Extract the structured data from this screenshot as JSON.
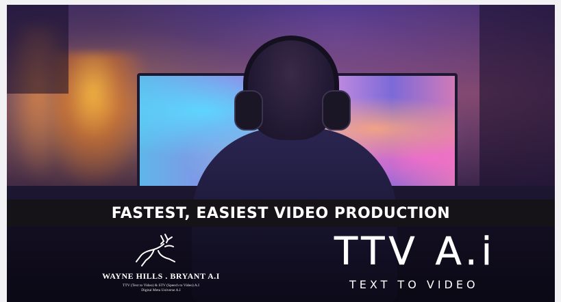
{
  "banner": {
    "headline": "FASTEST, EASIEST VIDEO PRODUCTION"
  },
  "brand_left": {
    "logo_icon": "deer-icon",
    "company": "WAYNE HILLS . BRYANT A.I",
    "tagline_line1": "TTV (Text to Video) & STV (Speech to Video) A.I",
    "tagline_line2": "Digital Meta Universe A.I"
  },
  "brand_right": {
    "logo": "TTV A.i",
    "subtitle": "TEXT TO VIDEO"
  },
  "colors": {
    "banner_bg": "#161318",
    "text": "#ffffff"
  }
}
